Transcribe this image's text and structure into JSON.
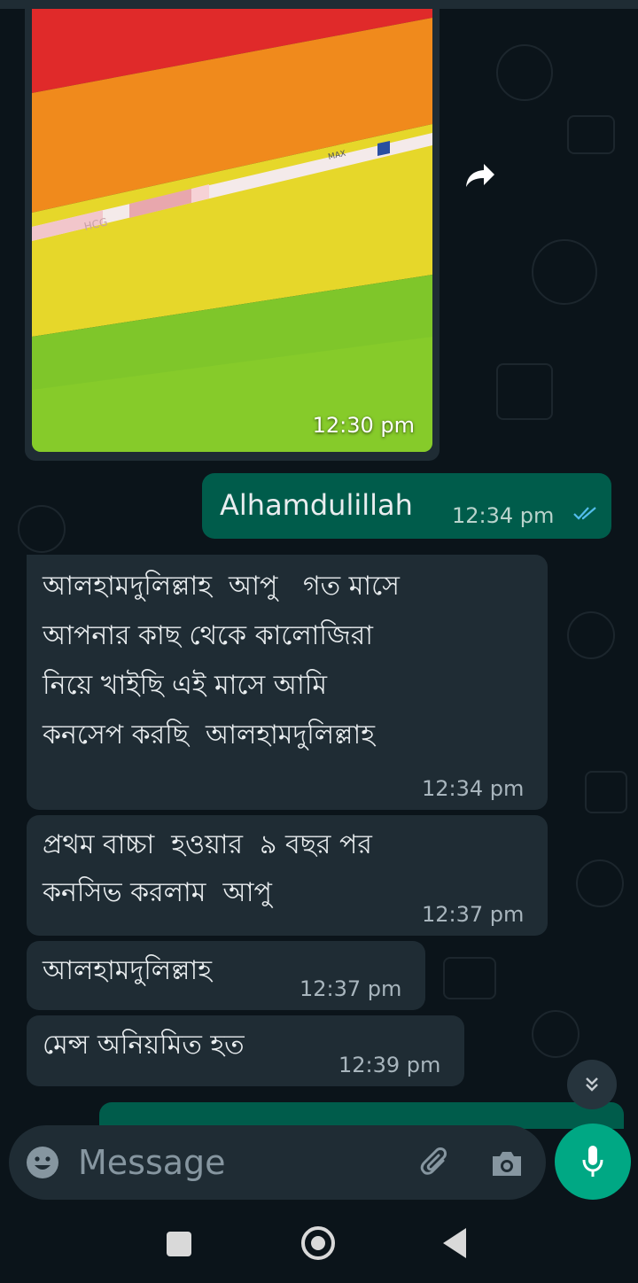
{
  "messages": [
    {
      "type": "image",
      "direction": "incoming",
      "time": "12:30 pm",
      "strip_text_1": "HCG",
      "strip_text_2": "MAX"
    },
    {
      "type": "text",
      "direction": "outgoing",
      "text": "Alhamdulillah",
      "time": "12:34 pm",
      "status_icon": "double-check-read-icon"
    },
    {
      "type": "text",
      "direction": "incoming",
      "lines": [
        "আলহামদুলিল্লাহ  আপু   গত মাসে",
        "আপনার কাছ থেকে কালোজিরা",
        "নিয়ে খাইছি এই মাসে আমি",
        "কনসেপ করছি  আলহামদুলিল্লাহ"
      ],
      "time": "12:34 pm"
    },
    {
      "type": "text",
      "direction": "incoming",
      "lines": [
        "প্রথম বাচ্চা  হওয়ার  ৯ বছর পর",
        "কনসিভ করলাম  আপু"
      ],
      "time": "12:37 pm"
    },
    {
      "type": "text",
      "direction": "incoming",
      "text": "আলহামদুলিল্লাহ",
      "time": "12:37 pm"
    },
    {
      "type": "text",
      "direction": "incoming",
      "text": "মেন্স অনিয়মিত হত",
      "time": "12:39 pm"
    }
  ],
  "input": {
    "placeholder": "Message"
  },
  "icons": {
    "emoji": "emoji-icon",
    "attach": "paperclip-icon",
    "camera": "camera-icon",
    "mic": "mic-icon",
    "scroll": "double-chevron-down-icon",
    "forward": "forward-icon"
  },
  "colors": {
    "background": "#0b141a",
    "incoming_bubble": "#1f2c34",
    "outgoing_bubble": "#005c4b",
    "accent": "#00a884",
    "read_tick": "#53bdeb"
  }
}
